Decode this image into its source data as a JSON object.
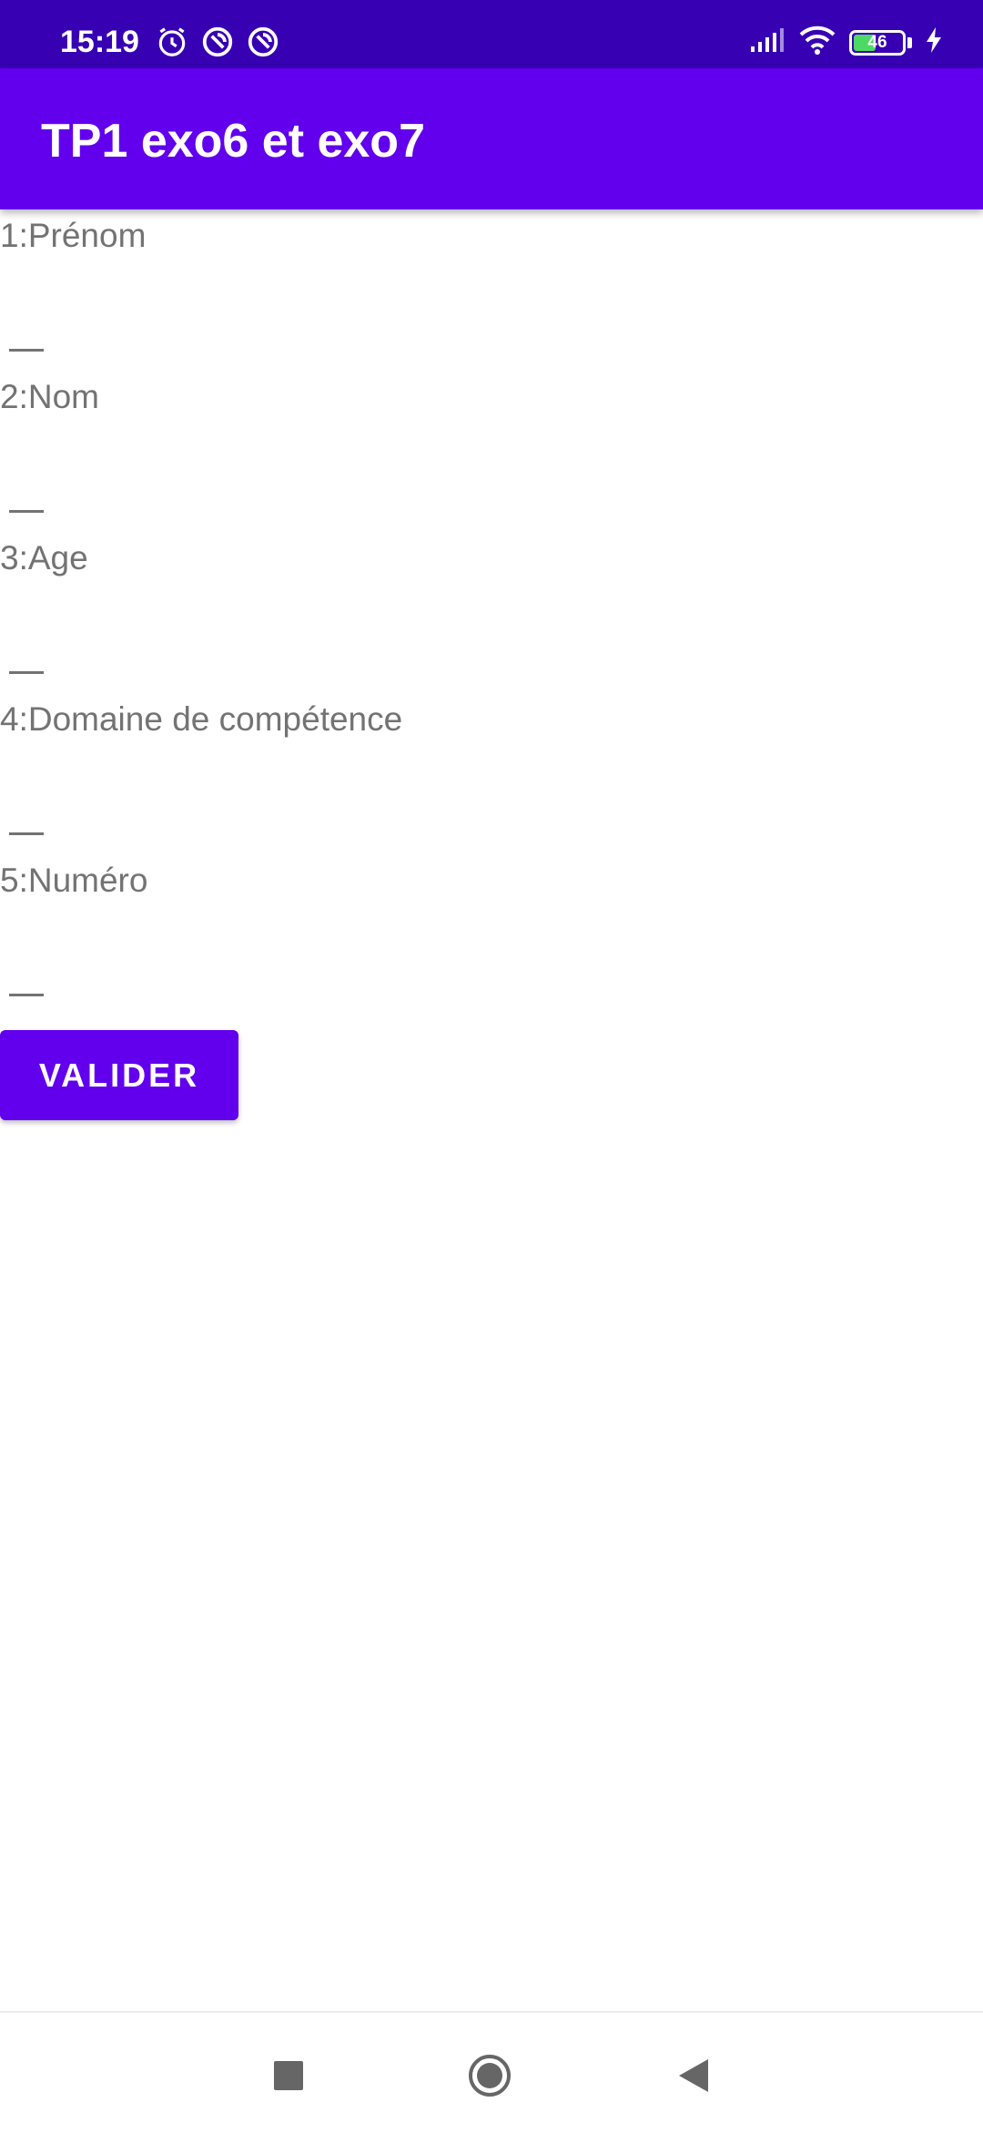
{
  "status_bar": {
    "time": "15:19",
    "battery_level": "46",
    "battery_fraction": 0.46,
    "icons": [
      "alarm-icon",
      "sync-icon",
      "sync-icon",
      "signal-icon",
      "wifi-icon",
      "battery-icon",
      "charging-icon"
    ]
  },
  "app_bar": {
    "title": "TP1 exo6 et exo7"
  },
  "form": {
    "fields": [
      {
        "label": "1:Prénom",
        "value": ""
      },
      {
        "label": "2:Nom",
        "value": ""
      },
      {
        "label": "3:Age",
        "value": ""
      },
      {
        "label": "4:Domaine de compétence",
        "value": ""
      },
      {
        "label": "5:Numéro",
        "value": ""
      }
    ],
    "submit_label": "VALIDER"
  },
  "nav_bar": {
    "buttons": [
      "recents-button",
      "home-button",
      "back-button"
    ]
  },
  "colors": {
    "status_bar": "#3700b3",
    "primary": "#6200ee",
    "label_text": "#737373",
    "battery_fill": "#4cd964"
  }
}
